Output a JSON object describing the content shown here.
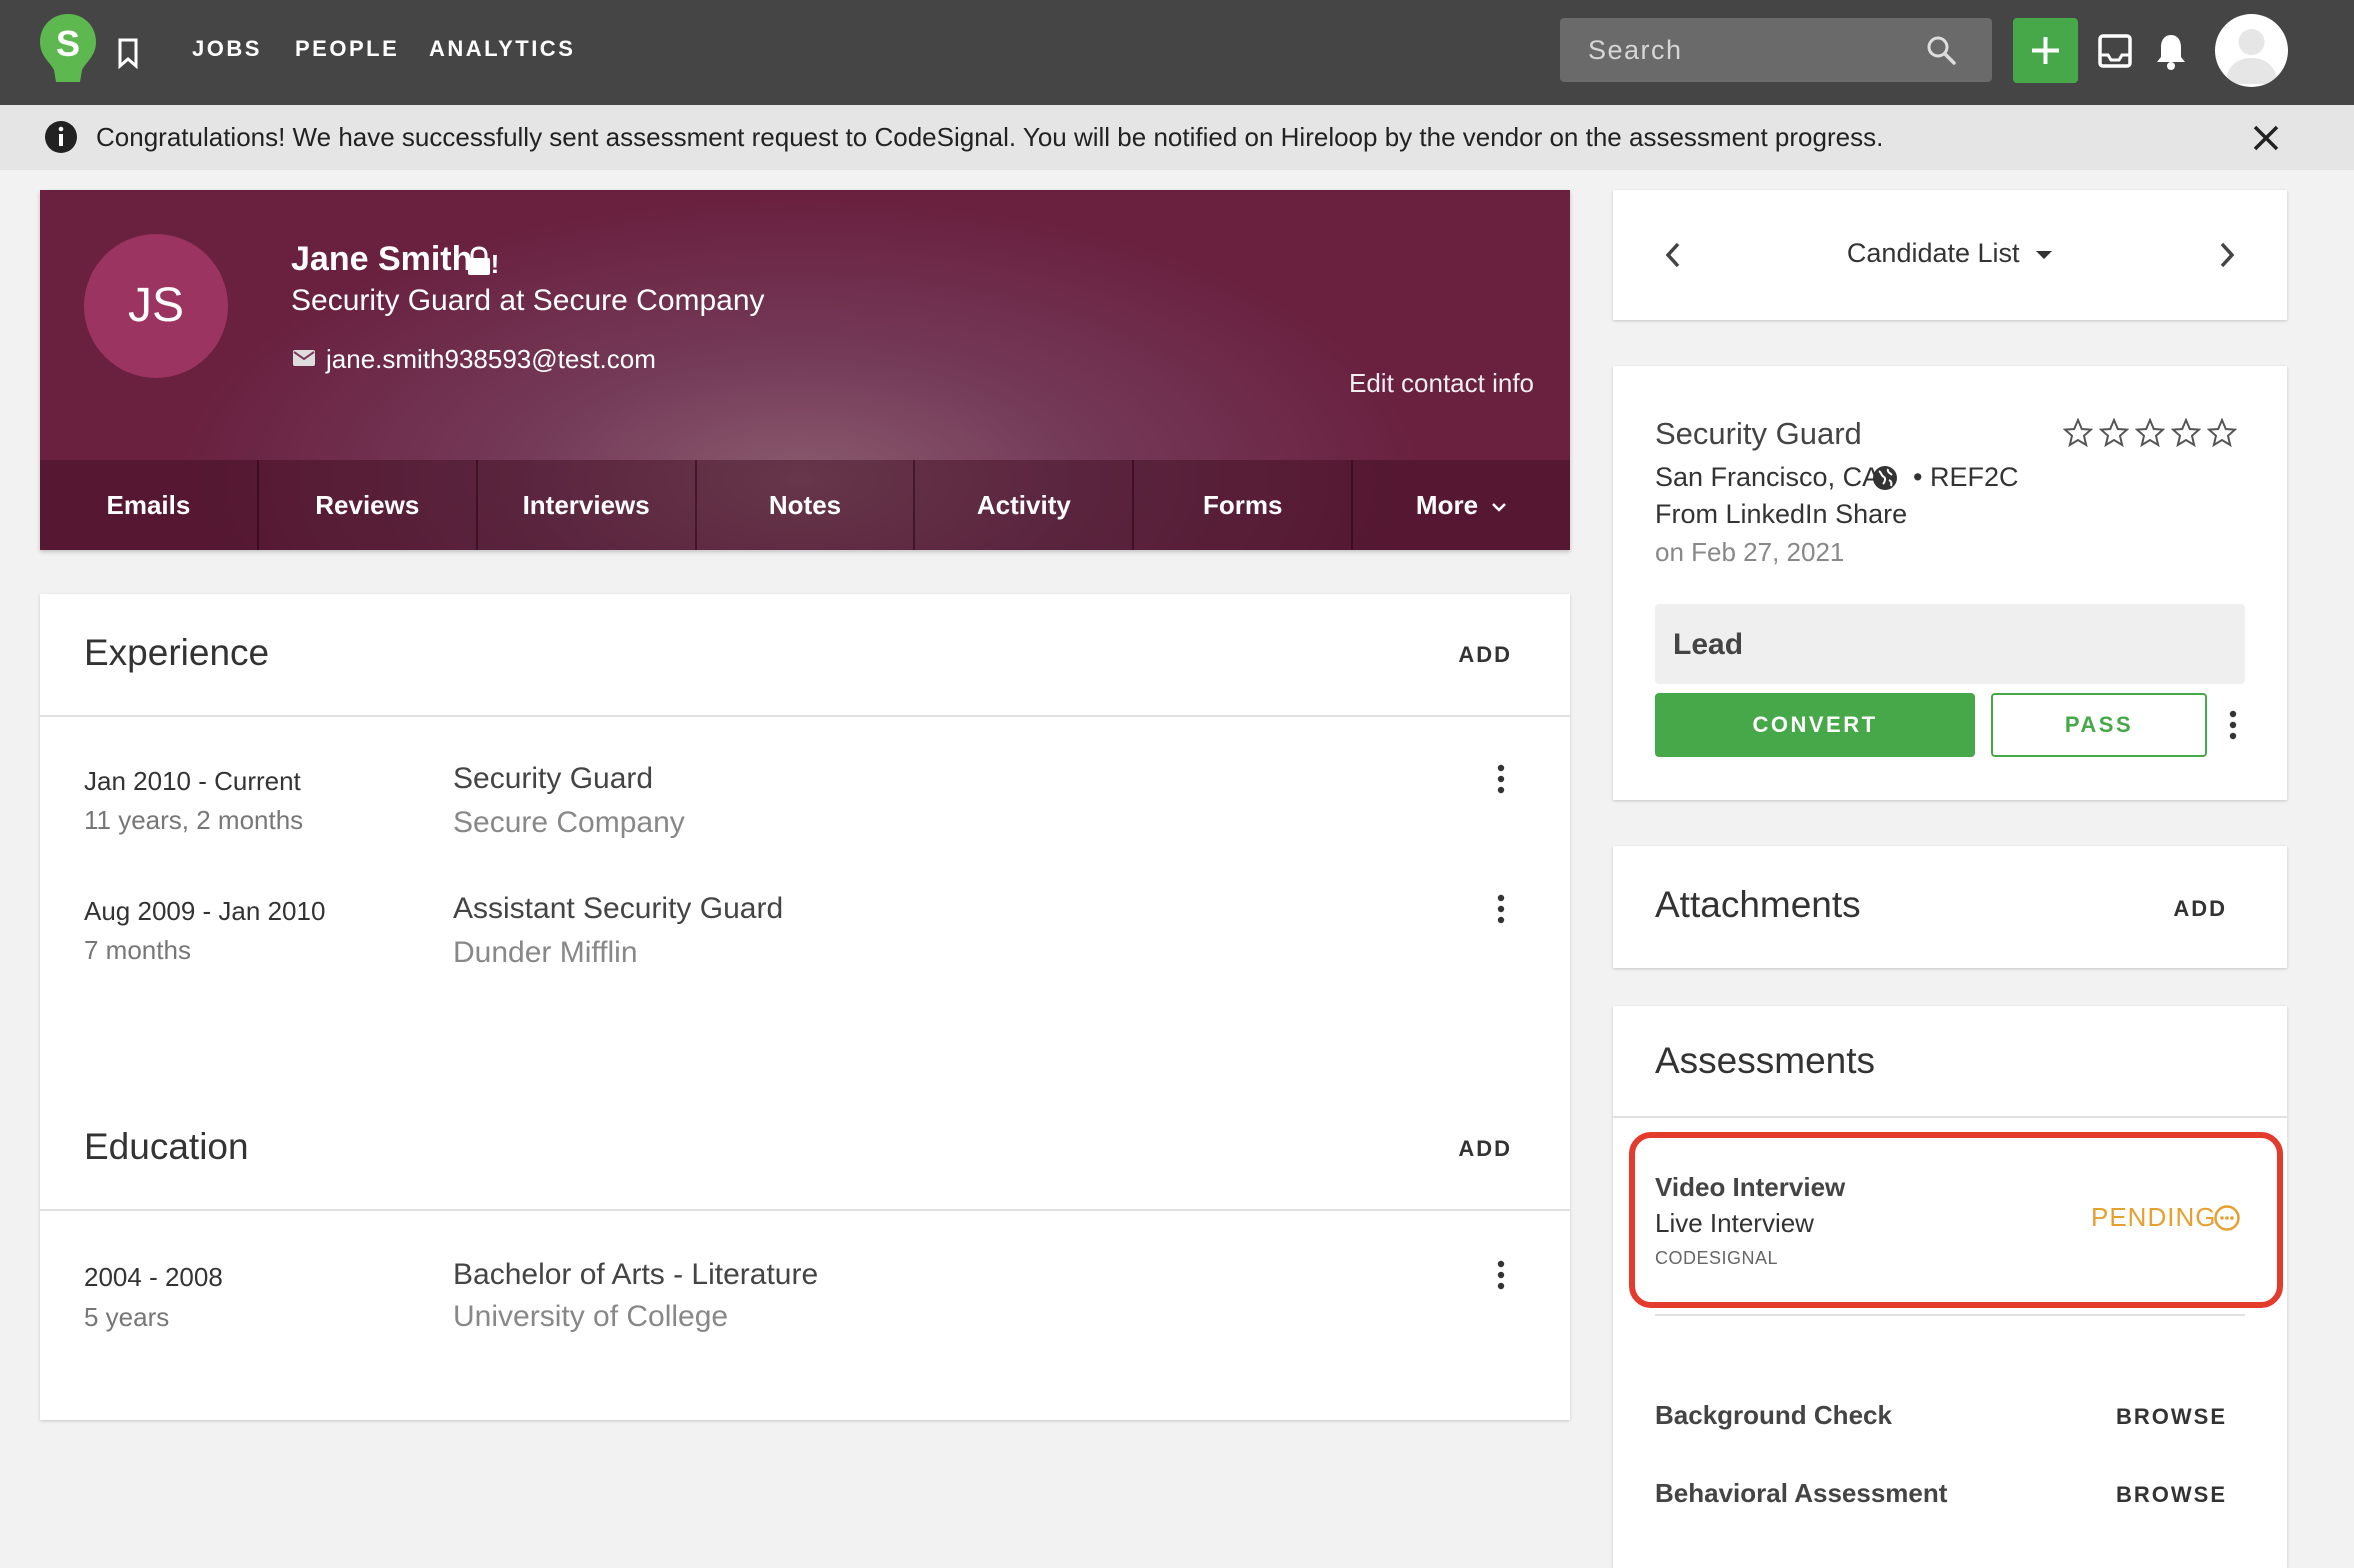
{
  "nav": {
    "logo_letter": "S",
    "links": [
      "JOBS",
      "PEOPLE",
      "ANALYTICS"
    ],
    "search_placeholder": "Search",
    "accent_color": "#46a849"
  },
  "banner": {
    "message": "Congratulations! We have successfully sent assessment request to CodeSignal. You will be notified on Hireloop by the vendor on the assessment progress."
  },
  "candidate": {
    "initials": "JS",
    "name": "Jane Smith",
    "lock_badge": "!",
    "headline": "Security Guard at Secure Company",
    "email": "jane.smith938593@test.com",
    "edit_contact_label": "Edit contact info",
    "tabs": [
      "Emails",
      "Reviews",
      "Interviews",
      "Notes",
      "Activity",
      "Forms",
      "More"
    ],
    "header_color": "#6a2140"
  },
  "experience": {
    "title": "Experience",
    "add_label": "ADD",
    "items": [
      {
        "dates": "Jan 2010 - Current",
        "duration": "11 years, 2 months",
        "title": "Security Guard",
        "company": "Secure Company"
      },
      {
        "dates": "Aug 2009 - Jan 2010",
        "duration": "7 months",
        "title": "Assistant Security Guard",
        "company": "Dunder Mifflin"
      }
    ]
  },
  "education": {
    "title": "Education",
    "add_label": "ADD",
    "items": [
      {
        "dates": "2004 - 2008",
        "duration": "5 years",
        "degree": "Bachelor of Arts - Literature",
        "school": "University of College"
      }
    ]
  },
  "candidate_list": {
    "label": "Candidate List"
  },
  "job": {
    "title": "Security Guard",
    "location": "San Francisco, CA",
    "ref": "REF2C",
    "source": "From LinkedIn Share",
    "date": "on Feb 27, 2021",
    "rating": 0,
    "rating_max": 5,
    "stage": "Lead",
    "convert_label": "CONVERT",
    "pass_label": "PASS"
  },
  "attachments": {
    "title": "Attachments",
    "add_label": "ADD"
  },
  "assessments": {
    "title": "Assessments",
    "active": {
      "type": "Video Interview",
      "name": "Live Interview",
      "vendor": "CODESIGNAL",
      "status": "PENDING",
      "status_color": "#e6a030",
      "highlight_color": "#e53b2c"
    },
    "others": [
      {
        "label": "Background Check",
        "action": "BROWSE"
      },
      {
        "label": "Behavioral Assessment",
        "action": "BROWSE"
      }
    ]
  }
}
